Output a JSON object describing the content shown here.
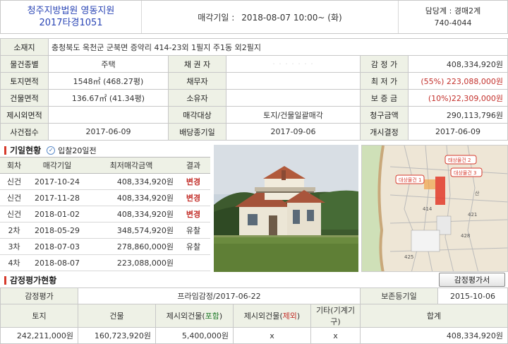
{
  "header": {
    "court": "청주지방법원 영동지원",
    "case_no": "2017타경1051",
    "sale_date_label": "매각기일 :",
    "sale_date": "2018-08-07  10:00~ (화)",
    "contact_label": "담당계 : 경매2계",
    "contact_phone": "740-4044"
  },
  "info": {
    "address_label": "소재지",
    "address": "충청북도 옥천군 군북면 증약리 414-23외 1필지 주1동 외2필지",
    "rows": [
      {
        "l1": "물건종별",
        "v1": "주택",
        "l2": "채 권 자",
        "v2": "· · · · · · ·",
        "l3": "감 정 가",
        "v3": "408,334,920원"
      },
      {
        "l1": "토지면적",
        "v1": "1548㎡ (468.27평)",
        "l2": "채무자",
        "v2": "",
        "l3": "최 저 가",
        "v3": "(55%) 223,088,000원"
      },
      {
        "l1": "건물면적",
        "v1": "136.67㎡ (41.34평)",
        "l2": "소유자",
        "v2": "",
        "l3": "보 증 금",
        "v3": "(10%)22,309,000원"
      },
      {
        "l1": "제시외면적",
        "v1": "",
        "l2": "매각대상",
        "v2": "토지/건물일괄매각",
        "l3": "청구금액",
        "v3": "290,113,796원"
      },
      {
        "l1": "사건접수",
        "v1": "2017-06-09",
        "l2": "배당종기일",
        "v2": "2017-09-06",
        "l3": "개시결정",
        "v3": "2017-06-09"
      }
    ]
  },
  "history": {
    "title": "기일현황",
    "badge": "입찰20일전",
    "headers": [
      "회차",
      "매각기일",
      "최저매각금액",
      "결과"
    ],
    "rows": [
      {
        "round": "신건",
        "date": "2017-10-24",
        "price": "408,334,920원",
        "result": "변경"
      },
      {
        "round": "신건",
        "date": "2017-11-28",
        "price": "408,334,920원",
        "result": "변경"
      },
      {
        "round": "신건",
        "date": "2018-01-02",
        "price": "408,334,920원",
        "result": "변경"
      },
      {
        "round": "2차",
        "date": "2018-05-29",
        "price": "348,574,920원",
        "result": "유찰"
      },
      {
        "round": "3차",
        "date": "2018-07-03",
        "price": "278,860,000원",
        "result": "유찰"
      },
      {
        "round": "4차",
        "date": "2018-08-07",
        "price": "223,088,000원",
        "result": ""
      }
    ]
  },
  "map_labels": {
    "l1": "태상물건 2",
    "l2": "대상물건 3",
    "l3": "대상물건 1",
    "n1": "414",
    "n2": "산",
    "n3": "421",
    "n4": "428",
    "n5": "425"
  },
  "appraisal": {
    "title": "감정평가현황",
    "button": "감정평가서",
    "row1": {
      "l1": "감정평가",
      "v1": "프라임감정/2017-06-22",
      "l2": "보존등기일",
      "v2": "2015-10-06"
    },
    "headers": {
      "land": "토지",
      "bldg": "건물",
      "inc_pre": "제시외건물(",
      "inc": "포함",
      "inc_post": ")",
      "exc_pre": "제시외건물(",
      "exc": "제외",
      "exc_post": ")",
      "etc": "기타(기계기구)",
      "total": "합계"
    },
    "values": {
      "land": "242,211,000원",
      "bldg": "160,723,920원",
      "inc": "5,400,000원",
      "exc": "x",
      "etc": "x",
      "total": "408,334,920원"
    }
  },
  "colors": {
    "accent": "#d63a2c",
    "court_blue": "#2a45b5",
    "header_bg": "#eef1e6"
  }
}
